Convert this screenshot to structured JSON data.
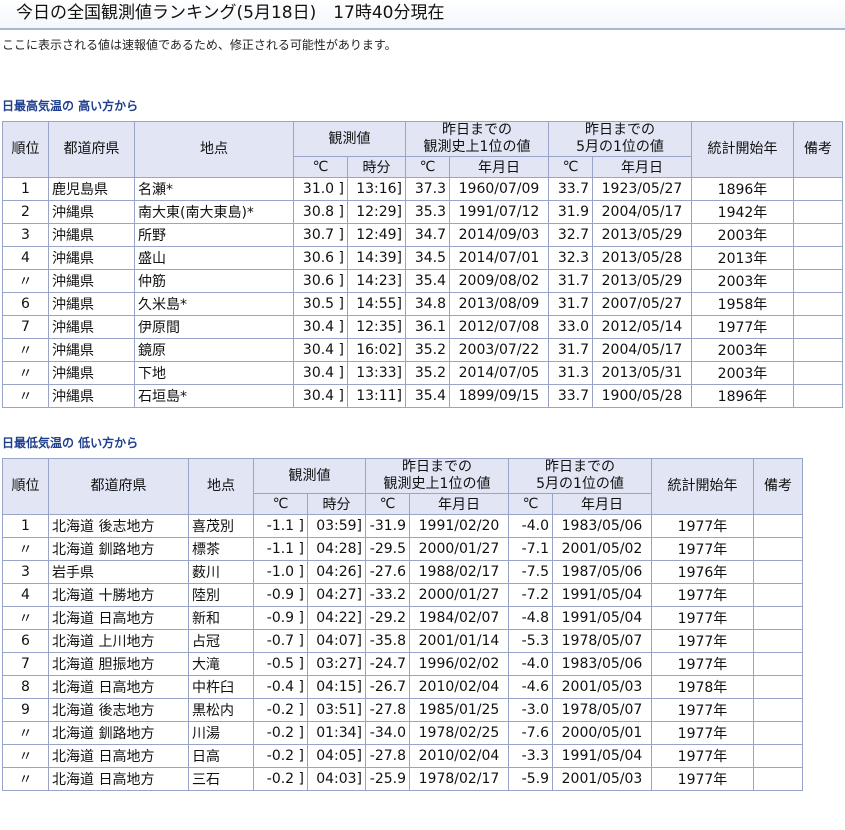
{
  "page": {
    "title": "今日の全国観測値ランキング(5月18日)　17時40分現在",
    "notice": "ここに表示される値は速報値であるため、修正される可能性があります。"
  },
  "headers": {
    "rank": "順位",
    "pref": "都道府県",
    "station": "地点",
    "obs": "観測値",
    "record_all": "昨日までの\n観測史上1位の値",
    "record_month": "昨日までの\n5月の1位の値",
    "stats_start": "統計開始年",
    "remarks": "備考",
    "deg": "℃",
    "time": "時分",
    "date": "年月日"
  },
  "high_temp": {
    "heading": "日最高気温の 高い方から",
    "rows": [
      {
        "rank": "1",
        "pref": "鹿児島県",
        "station": "名瀬*",
        "obs": "31.0 ]",
        "time": "13:16]",
        "rec": "37.3",
        "rec_date": "1960/07/09",
        "mrec": "33.7",
        "mrec_date": "1923/05/27",
        "start": "1896年",
        "note": ""
      },
      {
        "rank": "2",
        "pref": "沖縄県",
        "station": "南大東(南大東島)*",
        "obs": "30.8 ]",
        "time": "12:29]",
        "rec": "35.3",
        "rec_date": "1991/07/12",
        "mrec": "31.9",
        "mrec_date": "2004/05/17",
        "start": "1942年",
        "note": ""
      },
      {
        "rank": "3",
        "pref": "沖縄県",
        "station": "所野",
        "obs": "30.7 ]",
        "time": "12:49]",
        "rec": "34.7",
        "rec_date": "2014/09/03",
        "mrec": "32.7",
        "mrec_date": "2013/05/29",
        "start": "2003年",
        "note": ""
      },
      {
        "rank": "4",
        "pref": "沖縄県",
        "station": "盛山",
        "obs": "30.6 ]",
        "time": "14:39]",
        "rec": "34.5",
        "rec_date": "2014/07/01",
        "mrec": "32.3",
        "mrec_date": "2013/05/28",
        "start": "2013年",
        "note": ""
      },
      {
        "rank": "〃",
        "pref": "沖縄県",
        "station": "仲筋",
        "obs": "30.6 ]",
        "time": "14:23]",
        "rec": "35.4",
        "rec_date": "2009/08/02",
        "mrec": "31.7",
        "mrec_date": "2013/05/29",
        "start": "2003年",
        "note": ""
      },
      {
        "rank": "6",
        "pref": "沖縄県",
        "station": "久米島*",
        "obs": "30.5 ]",
        "time": "14:55]",
        "rec": "34.8",
        "rec_date": "2013/08/09",
        "mrec": "31.7",
        "mrec_date": "2007/05/27",
        "start": "1958年",
        "note": ""
      },
      {
        "rank": "7",
        "pref": "沖縄県",
        "station": "伊原間",
        "obs": "30.4 ]",
        "time": "12:35]",
        "rec": "36.1",
        "rec_date": "2012/07/08",
        "mrec": "33.0",
        "mrec_date": "2012/05/14",
        "start": "1977年",
        "note": ""
      },
      {
        "rank": "〃",
        "pref": "沖縄県",
        "station": "鏡原",
        "obs": "30.4 ]",
        "time": "16:02]",
        "rec": "35.2",
        "rec_date": "2003/07/22",
        "mrec": "31.7",
        "mrec_date": "2004/05/17",
        "start": "2003年",
        "note": ""
      },
      {
        "rank": "〃",
        "pref": "沖縄県",
        "station": "下地",
        "obs": "30.4 ]",
        "time": "13:33]",
        "rec": "35.2",
        "rec_date": "2014/07/05",
        "mrec": "31.3",
        "mrec_date": "2013/05/31",
        "start": "2003年",
        "note": ""
      },
      {
        "rank": "〃",
        "pref": "沖縄県",
        "station": "石垣島*",
        "obs": "30.4 ]",
        "time": "13:11]",
        "rec": "35.4",
        "rec_date": "1899/09/15",
        "mrec": "33.7",
        "mrec_date": "1900/05/28",
        "start": "1896年",
        "note": ""
      }
    ]
  },
  "low_temp": {
    "heading": "日最低気温の 低い方から",
    "rows": [
      {
        "rank": "1",
        "pref": "北海道 後志地方",
        "station": "喜茂別",
        "obs": "-1.1 ]",
        "time": "03:59]",
        "rec": "-31.9",
        "rec_date": "1991/02/20",
        "mrec": "-4.0",
        "mrec_date": "1983/05/06",
        "start": "1977年",
        "note": ""
      },
      {
        "rank": "〃",
        "pref": "北海道 釧路地方",
        "station": "標茶",
        "obs": "-1.1 ]",
        "time": "04:28]",
        "rec": "-29.5",
        "rec_date": "2000/01/27",
        "mrec": "-7.1",
        "mrec_date": "2001/05/02",
        "start": "1977年",
        "note": ""
      },
      {
        "rank": "3",
        "pref": "岩手県",
        "station": "薮川",
        "obs": "-1.0 ]",
        "time": "04:26]",
        "rec": "-27.6",
        "rec_date": "1988/02/17",
        "mrec": "-7.5",
        "mrec_date": "1987/05/06",
        "start": "1976年",
        "note": ""
      },
      {
        "rank": "4",
        "pref": "北海道 十勝地方",
        "station": "陸別",
        "obs": "-0.9 ]",
        "time": "04:27]",
        "rec": "-33.2",
        "rec_date": "2000/01/27",
        "mrec": "-7.2",
        "mrec_date": "1991/05/04",
        "start": "1977年",
        "note": ""
      },
      {
        "rank": "〃",
        "pref": "北海道 日高地方",
        "station": "新和",
        "obs": "-0.9 ]",
        "time": "04:22]",
        "rec": "-29.2",
        "rec_date": "1984/02/07",
        "mrec": "-4.8",
        "mrec_date": "1991/05/04",
        "start": "1977年",
        "note": ""
      },
      {
        "rank": "6",
        "pref": "北海道 上川地方",
        "station": "占冠",
        "obs": "-0.7 ]",
        "time": "04:07]",
        "rec": "-35.8",
        "rec_date": "2001/01/14",
        "mrec": "-5.3",
        "mrec_date": "1978/05/07",
        "start": "1977年",
        "note": ""
      },
      {
        "rank": "7",
        "pref": "北海道 胆振地方",
        "station": "大滝",
        "obs": "-0.5 ]",
        "time": "03:27]",
        "rec": "-24.7",
        "rec_date": "1996/02/02",
        "mrec": "-4.0",
        "mrec_date": "1983/05/06",
        "start": "1977年",
        "note": ""
      },
      {
        "rank": "8",
        "pref": "北海道 日高地方",
        "station": "中杵臼",
        "obs": "-0.4 ]",
        "time": "04:15]",
        "rec": "-26.7",
        "rec_date": "2010/02/04",
        "mrec": "-4.6",
        "mrec_date": "2001/05/03",
        "start": "1978年",
        "note": ""
      },
      {
        "rank": "9",
        "pref": "北海道 後志地方",
        "station": "黒松内",
        "obs": "-0.2 ]",
        "time": "03:51]",
        "rec": "-27.8",
        "rec_date": "1985/01/25",
        "mrec": "-3.0",
        "mrec_date": "1978/05/07",
        "start": "1977年",
        "note": ""
      },
      {
        "rank": "〃",
        "pref": "北海道 釧路地方",
        "station": "川湯",
        "obs": "-0.2 ]",
        "time": "01:34]",
        "rec": "-34.0",
        "rec_date": "1978/02/25",
        "mrec": "-7.6",
        "mrec_date": "2000/05/01",
        "start": "1977年",
        "note": ""
      },
      {
        "rank": "〃",
        "pref": "北海道 日高地方",
        "station": "日高",
        "obs": "-0.2 ]",
        "time": "04:05]",
        "rec": "-27.8",
        "rec_date": "2010/02/04",
        "mrec": "-3.3",
        "mrec_date": "1991/05/04",
        "start": "1977年",
        "note": ""
      },
      {
        "rank": "〃",
        "pref": "北海道 日高地方",
        "station": "三石",
        "obs": "-0.2 ]",
        "time": "04:03]",
        "rec": "-25.9",
        "rec_date": "1978/02/17",
        "mrec": "-5.9",
        "mrec_date": "2001/05/03",
        "start": "1977年",
        "note": ""
      }
    ]
  }
}
